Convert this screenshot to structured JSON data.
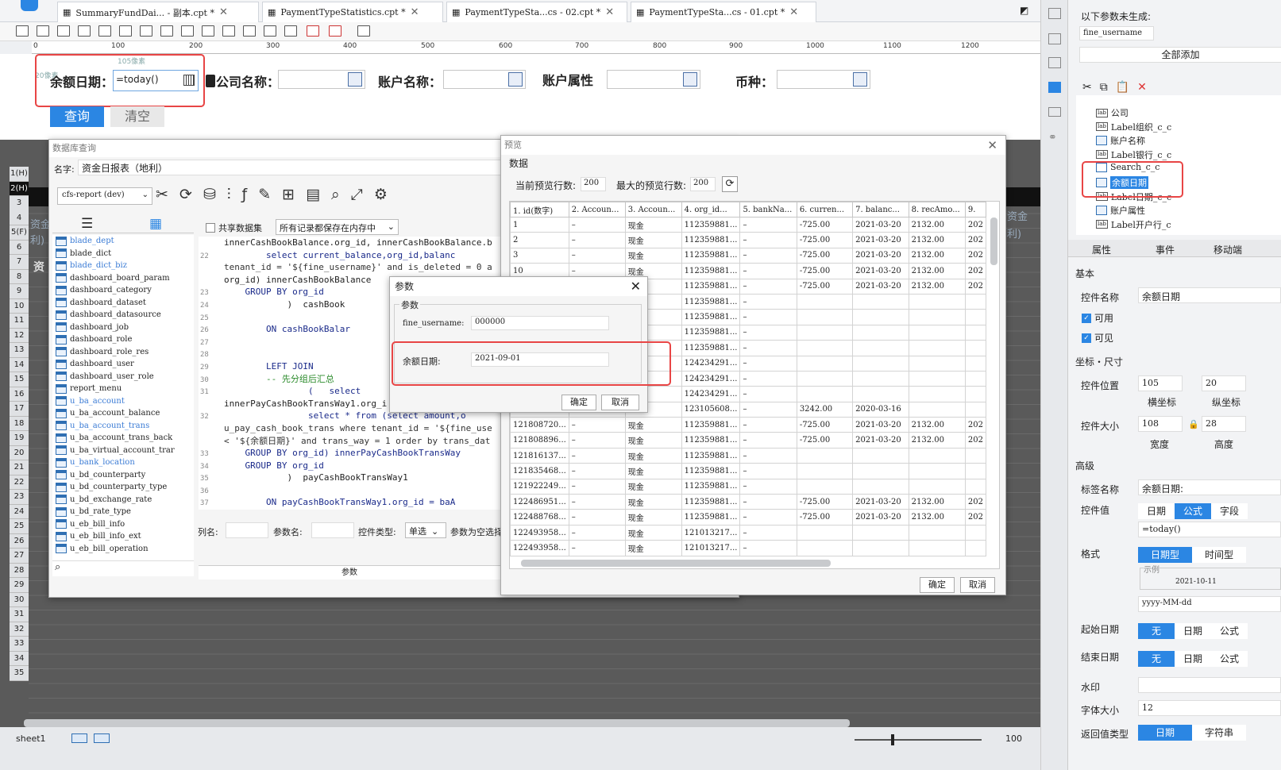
{
  "tabs": [
    {
      "label": "SummaryFundDai... - 副本.cpt *"
    },
    {
      "label": "PaymentTypeStatistics.cpt *"
    },
    {
      "label": "PaymentTypeSta...cs - 02.cpt *"
    },
    {
      "label": "PaymentTypeSta...cs - 01.cpt *"
    }
  ],
  "ruler": [
    "0",
    "100",
    "200",
    "300",
    "400",
    "500",
    "600",
    "700",
    "800",
    "900",
    "1000",
    "1100",
    "1200"
  ],
  "design": {
    "hint_top": "105像素",
    "hint_left": "20像素",
    "field_balance_date": "余额日期：",
    "balance_date_value": "=today()",
    "field_company": "公司名称：",
    "field_account": "账户名称：",
    "field_account_attr": "账户属性",
    "field_currency": "币种：",
    "query_button": "查询",
    "clear_button": "清空"
  },
  "sheet": {
    "rows": [
      "1(H)",
      "2(H)",
      "3",
      "4",
      "5(F)",
      "6",
      "7",
      "8",
      "9",
      "10",
      "11",
      "12",
      "13",
      "14",
      "15",
      "16",
      "17",
      "18",
      "19",
      "20",
      "21",
      "22",
      "23",
      "24",
      "25",
      "26",
      "27",
      "28",
      "29",
      "30",
      "31",
      "32",
      "33",
      "34",
      "35"
    ],
    "left_text_1": "资金",
    "left_text_2": "利)",
    "left_text_3": "资",
    "right_text_1": "资金",
    "right_text_2": "利)",
    "sheet_tab": "sheet1",
    "zoom": "100"
  },
  "dbquery": {
    "title": "数据库查询",
    "name_label": "名字:",
    "name_value": "资金日报表（地利）",
    "datasource": "cfs-report (dev)",
    "share_dataset": "共享数据集",
    "memory_option": "所有记录都保存在内存中",
    "tables": [
      "blade_dept",
      "blade_dict",
      "blade_dict_biz",
      "dashboard_board_param",
      "dashboard_category",
      "dashboard_dataset",
      "dashboard_datasource",
      "dashboard_job",
      "dashboard_role",
      "dashboard_role_res",
      "dashboard_user",
      "dashboard_user_role",
      "report_menu",
      "u_ba_account",
      "u_ba_account_balance",
      "u_ba_account_trans",
      "u_ba_account_trans_back",
      "u_ba_virtual_account_trar",
      "u_bank_location",
      "u_bd_counterparty",
      "u_bd_counterparty_type",
      "u_bd_exchange_rate",
      "u_bd_rate_type",
      "u_eb_bill_info",
      "u_eb_bill_info_ext",
      "u_eb_bill_operation"
    ],
    "col_name_label": "列名:",
    "param_name_label": "参数名:",
    "ctrl_type_label": "控件类型:",
    "ctrl_type_value": "单选",
    "param_null_label": "参数为空选择",
    "params_header": "参数"
  },
  "code": [
    {
      "n": "",
      "t": "innerCashBookBalance.org_id, innerCashBookBalance.b"
    },
    {
      "n": "22",
      "t": "        select current_balance,org_id,balanc"
    },
    {
      "n": "",
      "t": "tenant_id = '${fine_username}' and is_deleted = 0 a"
    },
    {
      "n": "",
      "t": "org_id) innerCashBookBalance"
    },
    {
      "n": "23",
      "t": "    GROUP BY org_id"
    },
    {
      "n": "24",
      "t": "            )  cashBook"
    },
    {
      "n": "25",
      "t": ""
    },
    {
      "n": "26",
      "t": "        ON cashBookBalar"
    },
    {
      "n": "27",
      "t": ""
    },
    {
      "n": "28",
      "t": ""
    },
    {
      "n": "29",
      "t": "        LEFT JOIN"
    },
    {
      "n": "30",
      "t": "        -- 先分组后汇总"
    },
    {
      "n": "31",
      "t": "                (   select"
    },
    {
      "n": "",
      "t": "innerPayCashBookTransWay1.org_i"
    },
    {
      "n": "32",
      "t": "                select * from (select amount,o"
    },
    {
      "n": "",
      "t": "u_pay_cash_book_trans where tenant_id = '${fine_use"
    },
    {
      "n": "",
      "t": "< '${余额日期}' and trans_way = 1 order by trans_dat"
    },
    {
      "n": "33",
      "t": "    GROUP BY org_id) innerPayCashBookTransWay"
    },
    {
      "n": "34",
      "t": "    GROUP BY org_id"
    },
    {
      "n": "35",
      "t": "            )  payCashBookTransWay1"
    },
    {
      "n": "36",
      "t": ""
    },
    {
      "n": "37",
      "t": "        ON payCashBookTransWay1.org_id = baA"
    }
  ],
  "preview": {
    "title": "预览",
    "data_label": "数据",
    "cur_rows_label": "当前预览行数:",
    "cur_rows": "200",
    "max_rows_label": "最大的预览行数:",
    "max_rows": "200",
    "headers": [
      "1. id(数字)",
      "2. Accoun...",
      "3. Accoun...",
      "4. org_id...",
      "5. bankNa...",
      "6. curren...",
      "7. balanc...",
      "8. recAmo...",
      "9."
    ],
    "rows": [
      [
        "1",
        "–",
        "现金",
        "112359881...",
        "–",
        "-725.00",
        "2021-03-20",
        "2132.00",
        "202"
      ],
      [
        "2",
        "–",
        "现金",
        "112359881...",
        "–",
        "-725.00",
        "2021-03-20",
        "2132.00",
        "202"
      ],
      [
        "3",
        "–",
        "现金",
        "112359881...",
        "–",
        "-725.00",
        "2021-03-20",
        "2132.00",
        "202"
      ],
      [
        "10",
        "–",
        "现金",
        "112359881...",
        "–",
        "-725.00",
        "2021-03-20",
        "2132.00",
        "202"
      ],
      [
        "",
        "",
        "",
        "112359881...",
        "–",
        "-725.00",
        "2021-03-20",
        "2132.00",
        "202"
      ],
      [
        "",
        "",
        "",
        "112359881...",
        "–",
        "",
        "",
        "",
        ""
      ],
      [
        "",
        "",
        "",
        "112359881...",
        "–",
        "",
        "",
        "",
        ""
      ],
      [
        "",
        "",
        "",
        "112359881...",
        "–",
        "",
        "",
        "",
        ""
      ],
      [
        "",
        "",
        "",
        "112359881...",
        "–",
        "",
        "",
        "",
        ""
      ],
      [
        "",
        "",
        "",
        "124234291...",
        "–",
        "",
        "",
        "",
        ""
      ],
      [
        "",
        "",
        "",
        "124234291...",
        "–",
        "",
        "",
        "",
        ""
      ],
      [
        "",
        "",
        "",
        "124234291...",
        "–",
        "",
        "",
        "",
        ""
      ],
      [
        "",
        "",
        "",
        "123105608...",
        "–",
        "3242.00",
        "2020-03-16",
        "",
        ""
      ],
      [
        "121808720...",
        "–",
        "现金",
        "112359881...",
        "–",
        "-725.00",
        "2021-03-20",
        "2132.00",
        "202"
      ],
      [
        "121808896...",
        "–",
        "现金",
        "112359881...",
        "–",
        "-725.00",
        "2021-03-20",
        "2132.00",
        "202"
      ],
      [
        "121816137...",
        "–",
        "现金",
        "112359881...",
        "–",
        "",
        "",
        "",
        ""
      ],
      [
        "121835468...",
        "–",
        "现金",
        "112359881...",
        "–",
        "",
        "",
        "",
        ""
      ],
      [
        "121922249...",
        "–",
        "现金",
        "112359881...",
        "–",
        "",
        "",
        "",
        ""
      ],
      [
        "122486951...",
        "–",
        "现金",
        "112359881...",
        "–",
        "-725.00",
        "2021-03-20",
        "2132.00",
        "202"
      ],
      [
        "122488768...",
        "–",
        "现金",
        "112359881...",
        "–",
        "-725.00",
        "2021-03-20",
        "2132.00",
        "202"
      ],
      [
        "122493958...",
        "–",
        "现金",
        "121013217...",
        "–",
        "",
        "",
        "",
        ""
      ],
      [
        "122493958...",
        "–",
        "现金",
        "121013217...",
        "–",
        "",
        "",
        "",
        ""
      ]
    ],
    "ok": "确定",
    "cancel": "取消"
  },
  "param_dialog": {
    "title": "参数",
    "group_label": "参数",
    "p1_label": "fine_username:",
    "p1_value": "000000",
    "p2_label": "余额日期:",
    "p2_value": "2021-09-01",
    "ok": "确定",
    "cancel": "取消"
  },
  "right": {
    "not_generated": "以下参数未生成:",
    "param_tag": "fine_username",
    "add_all": "全部添加",
    "tree": [
      {
        "icon": "label",
        "label": "公司"
      },
      {
        "icon": "label",
        "label": "Label组织_c_c"
      },
      {
        "icon": "table",
        "label": "账户名称"
      },
      {
        "icon": "label",
        "label": "Label银行_c_c"
      },
      {
        "icon": "search",
        "label": "Search_c_c"
      },
      {
        "icon": "table",
        "label": "余额日期"
      },
      {
        "icon": "label",
        "label": "Label日期_c_c"
      },
      {
        "icon": "table",
        "label": "账户属性"
      },
      {
        "icon": "label",
        "label": "Label开户行_c"
      }
    ],
    "tabs": [
      "属性",
      "事件",
      "移动端"
    ],
    "basic": "基本",
    "ctrl_name_label": "控件名称",
    "ctrl_name": "余额日期",
    "enabled": "可用",
    "visible": "可见",
    "coord_size": "坐标・尺寸",
    "pos_label": "控件位置",
    "pos_x": "105",
    "pos_y": "20",
    "x_label": "横坐标",
    "y_label": "纵坐标",
    "size_label": "控件大小",
    "width": "108",
    "height": "28",
    "w_label": "宽度",
    "h_label": "高度",
    "advanced": "高级",
    "tag_name_label": "标签名称",
    "tag_name": "余额日期:",
    "ctrl_value_label": "控件值",
    "value_types": [
      "日期",
      "公式",
      "字段"
    ],
    "formula": "=today()",
    "format_label": "格式",
    "format_types": [
      "日期型",
      "时间型"
    ],
    "sample_label": "示例",
    "sample": "2021-10-11",
    "pattern": "yyyy-MM-dd",
    "start_date_label": "起始日期",
    "end_date_label": "结束日期",
    "date_opts": [
      "无",
      "日期",
      "公式"
    ],
    "watermark_label": "水印",
    "font_size_label": "字体大小",
    "font_size": "12",
    "return_type_label": "返回值类型",
    "return_types": [
      "日期",
      "字符串"
    ]
  },
  "colors": {
    "accent": "#2b86e3",
    "highlight": "#e84545"
  }
}
